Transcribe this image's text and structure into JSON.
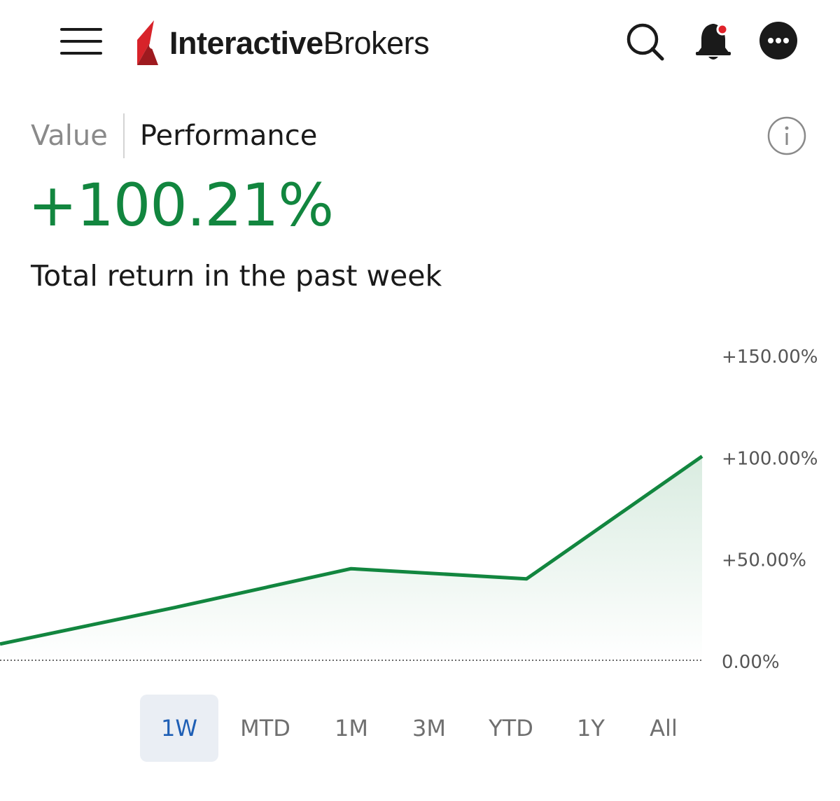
{
  "header": {
    "logo_bold": "Interactive",
    "logo_regular": "Brokers",
    "icons": [
      "hamburger-menu-icon",
      "search-icon",
      "bell-icon",
      "more-icon"
    ],
    "notification_dot_color": "#e0222a"
  },
  "tabs": {
    "value_label": "Value",
    "performance_label": "Performance",
    "selected": "Performance"
  },
  "summary": {
    "return_value": "+100.21%",
    "description": "Total return in the past week"
  },
  "colors": {
    "positive": "#12863f",
    "logo_red": "#d8232a",
    "active_range_text": "#1f5fb5",
    "active_range_bg": "#eaeef4"
  },
  "chart_data": {
    "type": "area",
    "x": [
      0,
      1,
      2,
      3,
      4
    ],
    "y": [
      8,
      26,
      45,
      40,
      100.21
    ],
    "ylim": [
      0,
      150
    ],
    "yticks": [
      "+150.00%",
      "+100.00%",
      "+50.00%",
      "0.00%"
    ],
    "ytick_values": [
      150,
      100,
      50,
      0
    ],
    "baseline": 0,
    "grid": false,
    "line_color": "#12863f"
  },
  "ranges": {
    "items": [
      "1W",
      "MTD",
      "1M",
      "3M",
      "YTD",
      "1Y",
      "All"
    ],
    "selected": "1W"
  }
}
